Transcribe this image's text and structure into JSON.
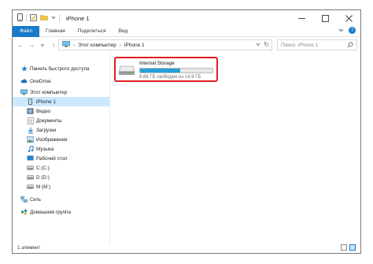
{
  "window": {
    "title": "iPhone 1"
  },
  "ribbon": {
    "tabs": [
      {
        "label": "Файл"
      },
      {
        "label": "Главная"
      },
      {
        "label": "Поделиться"
      },
      {
        "label": "Вид"
      }
    ]
  },
  "address": {
    "crumbs": [
      "Этот компьютер",
      "iPhone 1"
    ],
    "search_placeholder": "Поиск: iPhone 1"
  },
  "sidebar": {
    "items": [
      {
        "label": "Панель быстрого доступа",
        "icon": "star-icon"
      },
      {
        "label": "OneDrive",
        "icon": "cloud-icon"
      },
      {
        "label": "Этот компьютер",
        "icon": "computer-icon"
      },
      {
        "label": "iPhone 1",
        "icon": "phone-icon",
        "selected": true
      },
      {
        "label": "Видео",
        "icon": "video-folder-icon"
      },
      {
        "label": "Документы",
        "icon": "documents-folder-icon"
      },
      {
        "label": "Загрузки",
        "icon": "download-icon"
      },
      {
        "label": "Изображения",
        "icon": "pictures-folder-icon"
      },
      {
        "label": "Музыка",
        "icon": "music-icon"
      },
      {
        "label": "Рабочий стол",
        "icon": "desktop-folder-icon"
      },
      {
        "label": "C (C:)",
        "icon": "drive-icon"
      },
      {
        "label": "D (D:)",
        "icon": "drive-icon"
      },
      {
        "label": "M (M:)",
        "icon": "drive-icon"
      },
      {
        "label": "Сеть",
        "icon": "network-icon"
      },
      {
        "label": "Домашняя группа",
        "icon": "homegroup-icon"
      }
    ]
  },
  "drive": {
    "name": "Internal Storage",
    "free_text": "6,68 ГБ свободно из 14,9 ГБ",
    "used_fraction": 0.55,
    "highlight_color": "#e02020"
  },
  "status": {
    "count": "1 элемент"
  },
  "colors": {
    "accent": "#1979ca",
    "selection": "#cce8ff",
    "progress": "#26a0da"
  }
}
